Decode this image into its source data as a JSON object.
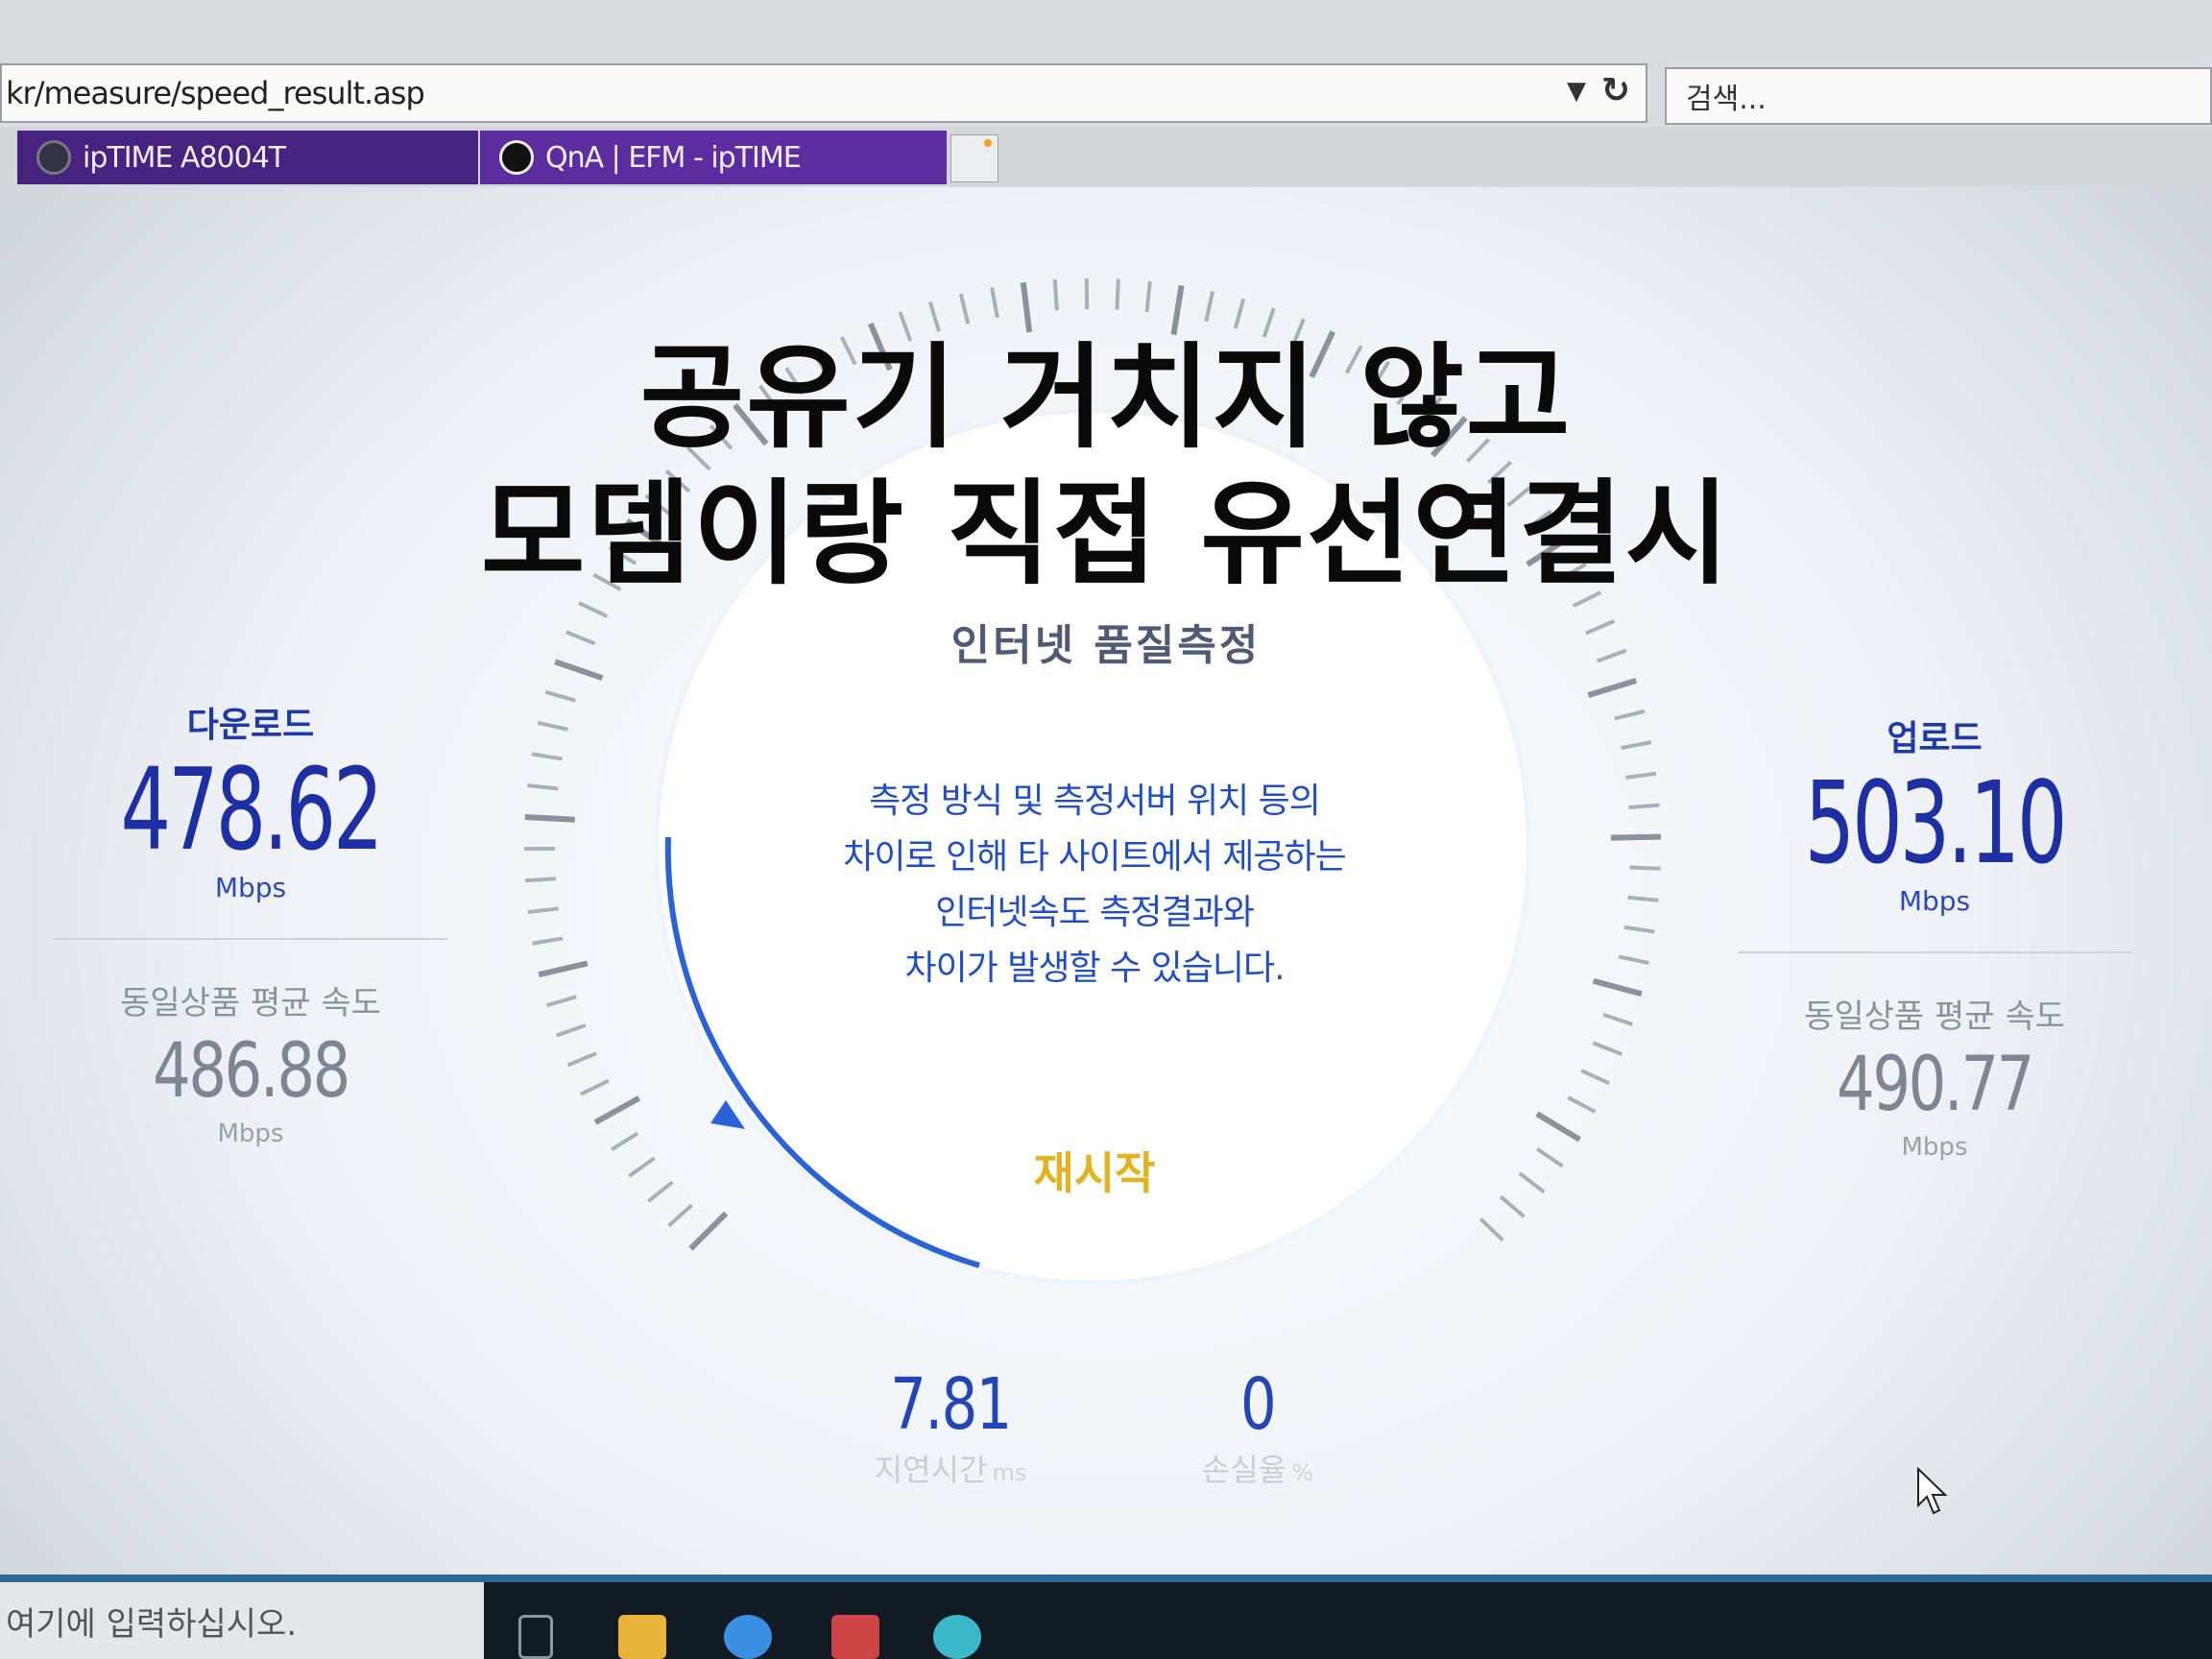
{
  "browser": {
    "address": "kr/measure/speed_result.asp",
    "search_placeholder": "검색...",
    "tabs": [
      {
        "label": "ipTIME A8004T"
      },
      {
        "label": "QnA | EFM - ipTIME"
      }
    ]
  },
  "caption": {
    "line1": "공유기 거치지 않고",
    "line2": "모뎀이랑 직접 유선연결시"
  },
  "gauge": {
    "title": "인터넷 품질측정",
    "notice": [
      "측정 방식 및 측정서버 위치 등의",
      "차이로 인해 타 사이트에서 제공하는",
      "인터넷속도 측정결과와",
      "차이가 발생할 수 있습니다."
    ],
    "restart_label": "재시작"
  },
  "download": {
    "label": "다운로드",
    "value": "478.62",
    "unit": "Mbps",
    "avg_label": "동일상품 평균 속도",
    "avg_value": "486.88",
    "avg_unit": "Mbps"
  },
  "upload": {
    "label": "업로드",
    "value": "503.10",
    "unit": "Mbps",
    "avg_label": "동일상품 평균 속도",
    "avg_value": "490.77",
    "avg_unit": "Mbps"
  },
  "latency": {
    "value": "7.81",
    "label": "지연시간",
    "unit": "ms"
  },
  "loss": {
    "value": "0",
    "label": "손실율",
    "unit": "%"
  },
  "taskbar": {
    "search_placeholder": "여기에 입력하십시오."
  },
  "colors": {
    "accent": "#1d2fa3",
    "restart": "#e2b21f",
    "tab": "#5b2d9e"
  }
}
